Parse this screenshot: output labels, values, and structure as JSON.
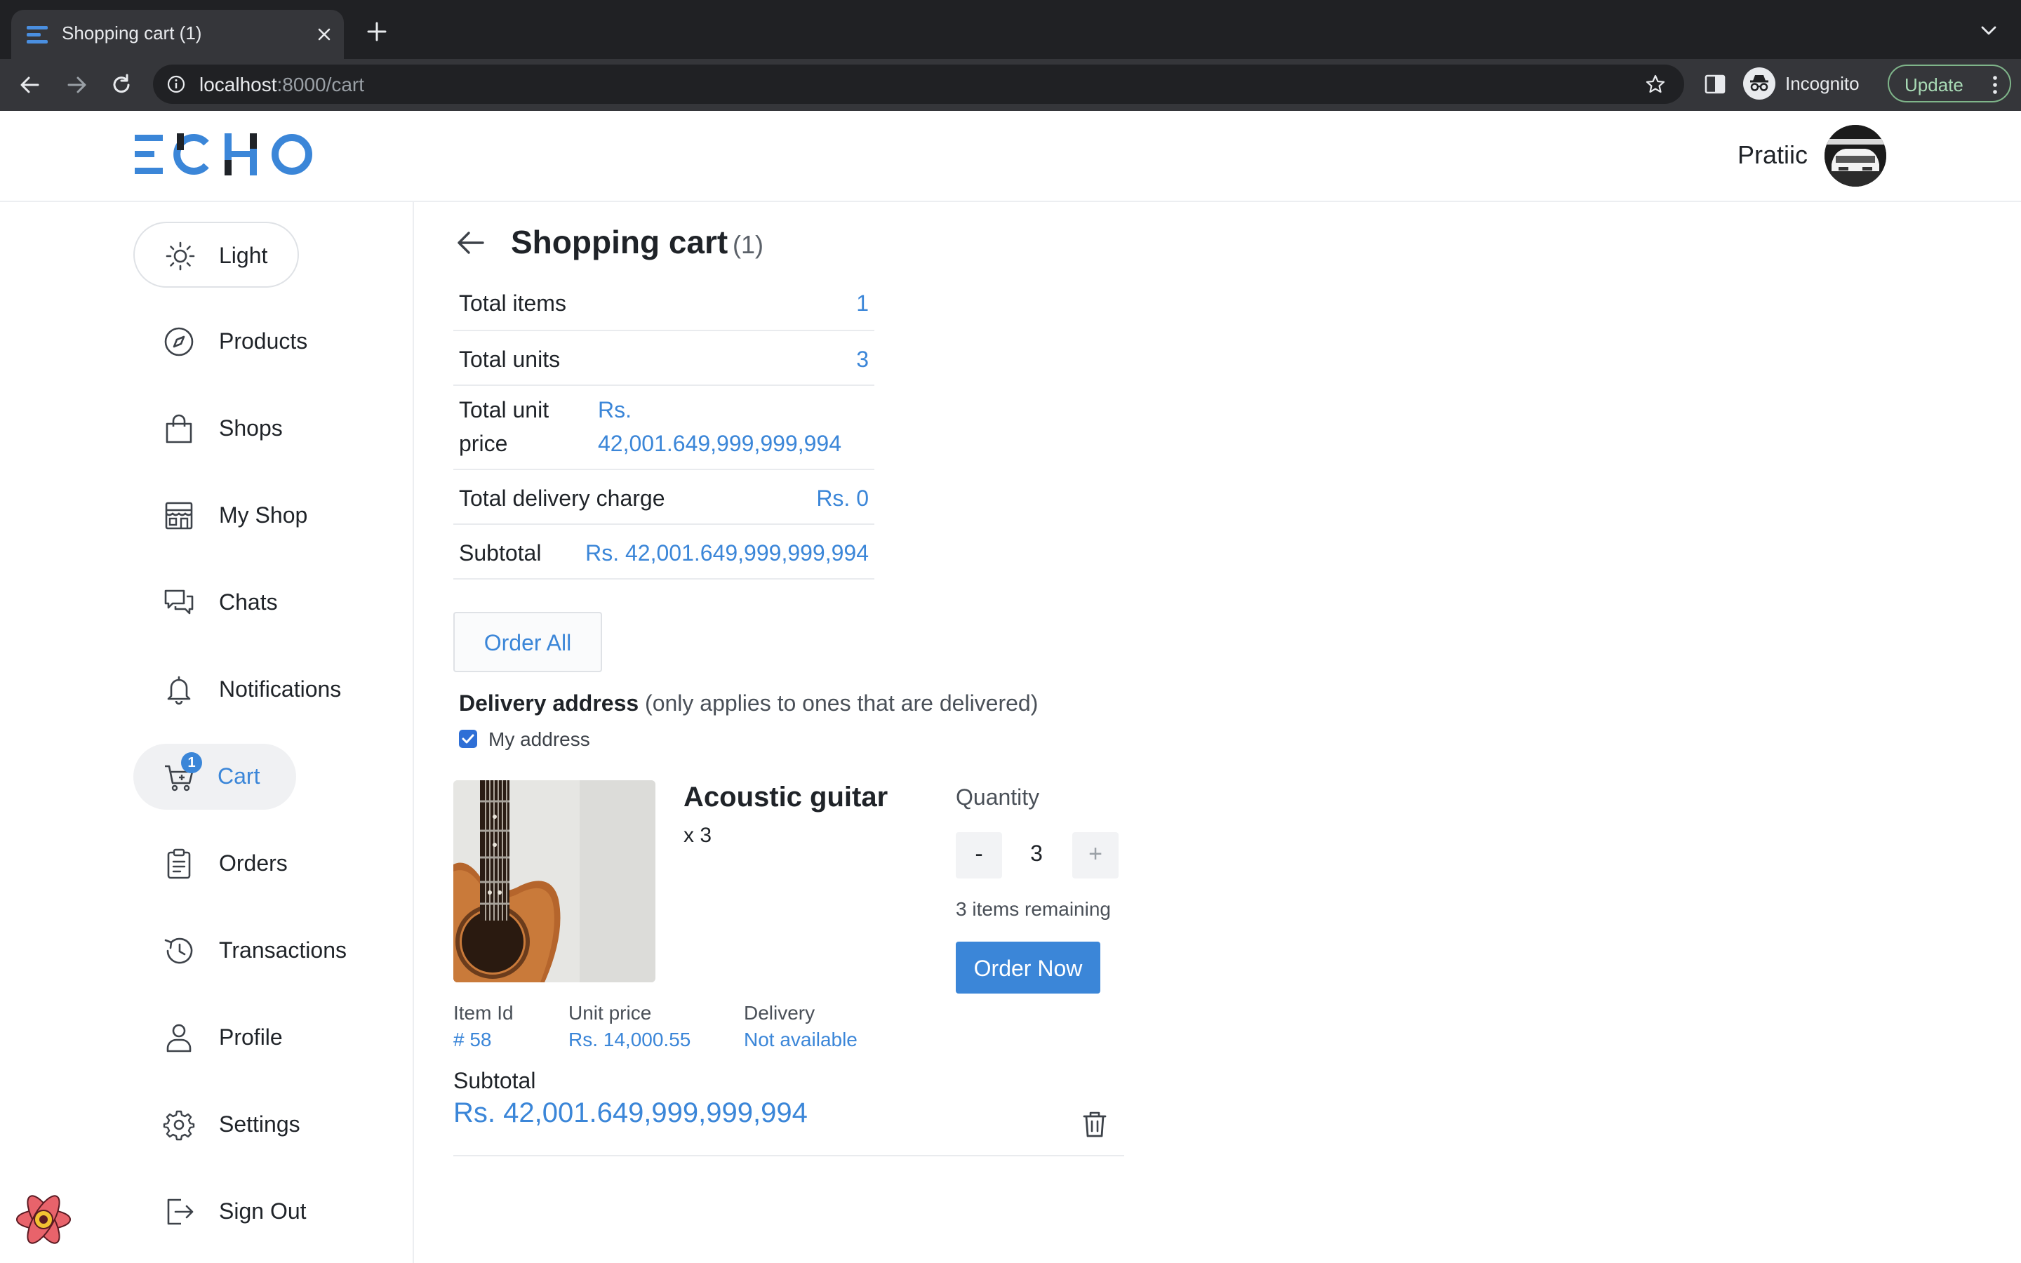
{
  "browser": {
    "tab_title": "Shopping cart (1)",
    "url_host": "localhost",
    "url_path": ":8000/cart",
    "profile_label": "Incognito",
    "update_label": "Update"
  },
  "header": {
    "logo_text": "ECHO",
    "username": "Pratiic"
  },
  "sidebar": {
    "theme_label": "Light",
    "items": [
      {
        "label": "Products",
        "icon": "compass-icon"
      },
      {
        "label": "Shops",
        "icon": "shopping-bag-icon"
      },
      {
        "label": "My Shop",
        "icon": "storefront-icon"
      },
      {
        "label": "Chats",
        "icon": "chat-bubbles-icon"
      },
      {
        "label": "Notifications",
        "icon": "bell-icon"
      },
      {
        "label": "Cart",
        "icon": "cart-icon",
        "badge": "1",
        "active": true
      },
      {
        "label": "Orders",
        "icon": "clipboard-icon"
      },
      {
        "label": "Transactions",
        "icon": "history-icon"
      },
      {
        "label": "Profile",
        "icon": "user-icon"
      },
      {
        "label": "Settings",
        "icon": "gear-icon"
      },
      {
        "label": "Sign Out",
        "icon": "sign-out-icon"
      }
    ]
  },
  "page": {
    "title": "Shopping cart",
    "count": "(1)"
  },
  "summary": {
    "total_items_label": "Total items",
    "total_items_value": "1",
    "total_units_label": "Total units",
    "total_units_value": "3",
    "total_unit_price_label_1": "Total unit",
    "total_unit_price_label_2": "price",
    "total_unit_price_value_1": "Rs.",
    "total_unit_price_value_2": "42,001.649,999,999,994",
    "delivery_charge_label": "Total delivery charge",
    "delivery_charge_value": "Rs. 0",
    "subtotal_label": "Subtotal",
    "subtotal_value": "Rs. 42,001.649,999,999,994"
  },
  "actions": {
    "order_all_label": "Order All"
  },
  "delivery": {
    "heading": "Delivery address",
    "note": "(only applies to ones that are delivered)",
    "my_address_label": "My address",
    "my_address_checked": true
  },
  "item": {
    "name": "Acoustic guitar",
    "qty_text": "x 3",
    "quantity_label": "Quantity",
    "decrement_label": "-",
    "increment_label": "+",
    "quantity_value": "3",
    "remaining_text": "3 items remaining",
    "order_now_label": "Order Now",
    "item_id_label": "Item Id",
    "item_id_value": "# 58",
    "unit_price_label": "Unit price",
    "unit_price_value": "Rs. 14,000.55",
    "delivery_label": "Delivery",
    "delivery_value": "Not available",
    "subtotal_label": "Subtotal",
    "subtotal_value": "Rs. 42,001.649,999,999,994"
  },
  "colors": {
    "accent": "#3b86d8",
    "text": "#1f2328",
    "browser_frame": "#202124"
  }
}
